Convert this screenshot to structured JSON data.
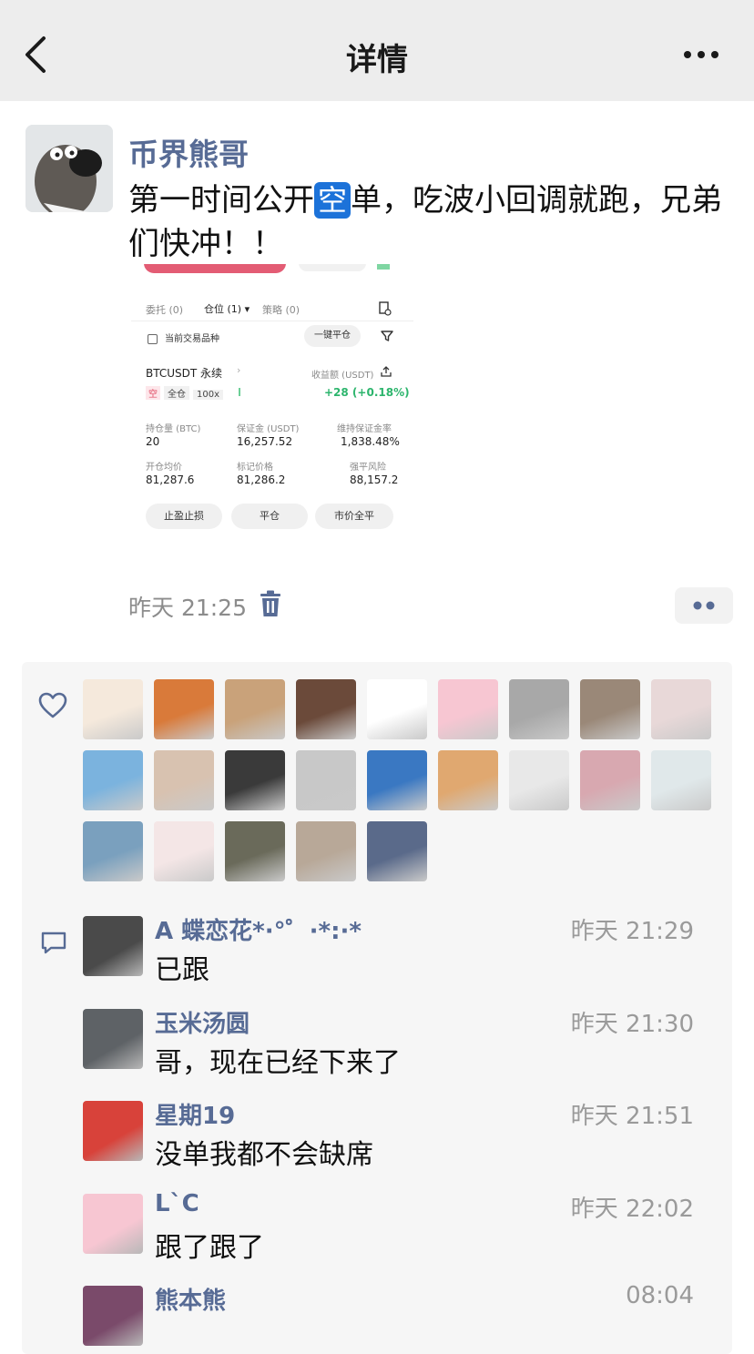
{
  "nav": {
    "title": "详情",
    "back_icon": "chevron-left-icon",
    "more_icon": "more-dots-icon"
  },
  "post": {
    "author": "币界熊哥",
    "text_before": "第一时间公开",
    "highlight": "空",
    "text_after": "单，吃波小回调就跑，兄弟们快冲！！",
    "time": "昨天 21:25",
    "screenshot": {
      "tabs": [
        "委托 (0)",
        "仓位 (1) ▾",
        "策略 (0)"
      ],
      "filter_label": "当前交易品种",
      "close_all": "一键平仓",
      "symbol": "BTCUSDT 永续",
      "pnl_label": "收益额 (USDT)",
      "pnl_value": "+28 (+0.18%)",
      "side": "空",
      "margin_mode": "全仓",
      "leverage": "100x",
      "stats": [
        {
          "label": "持仓量 (BTC)",
          "value": "20"
        },
        {
          "label": "保证金 (USDT)",
          "value": "16,257.52"
        },
        {
          "label": "维持保证金率",
          "value": "1,838.48%"
        },
        {
          "label": "开仓均价",
          "value": "81,287.6"
        },
        {
          "label": "标记价格",
          "value": "81,286.2"
        },
        {
          "label": "强平风险",
          "value": "88,157.2"
        }
      ],
      "buttons": [
        "止盈止损",
        "平仓",
        "市价全平"
      ]
    }
  },
  "likes": {
    "icon": "heart-icon",
    "avatars": [
      "#f5e9dc",
      "#d97a3a",
      "#c9a27a",
      "#6b4a3a",
      "#ffffff",
      "#f7c6d2",
      "#a8a8a8",
      "#9a8878",
      "#e8d8d8",
      "#7bb3de",
      "#d8c2b0",
      "#3a3a3a",
      "#c8c8c8",
      "#3a78c2",
      "#e0a870",
      "#e8e8e8",
      "#d8a8b0",
      "#e0e8ea",
      "#7aa0be",
      "#f4e6e6",
      "#6a6a5a",
      "#b8a898",
      "#5a6a8a"
    ]
  },
  "comments": {
    "icon": "comment-icon",
    "items": [
      {
        "name": "A  蝶恋花*·°゜·*:·*",
        "time": "昨天 21:29",
        "text": "已跟",
        "color": "#4a4a4a"
      },
      {
        "name": "玉米汤圆",
        "time": "昨天 21:30",
        "text": "哥，现在已经下来了",
        "color": "#5e6266"
      },
      {
        "name": "星期19",
        "time": "昨天 21:51",
        "text": "没单我都不会缺席",
        "color": "#d8423a"
      },
      {
        "name": "L`C",
        "time": "昨天 22:02",
        "text": "跟了跟了",
        "color": "#f7c6d2"
      },
      {
        "name": "熊本熊",
        "time": "08:04",
        "text": "",
        "color": "#7a4a6a"
      }
    ]
  }
}
